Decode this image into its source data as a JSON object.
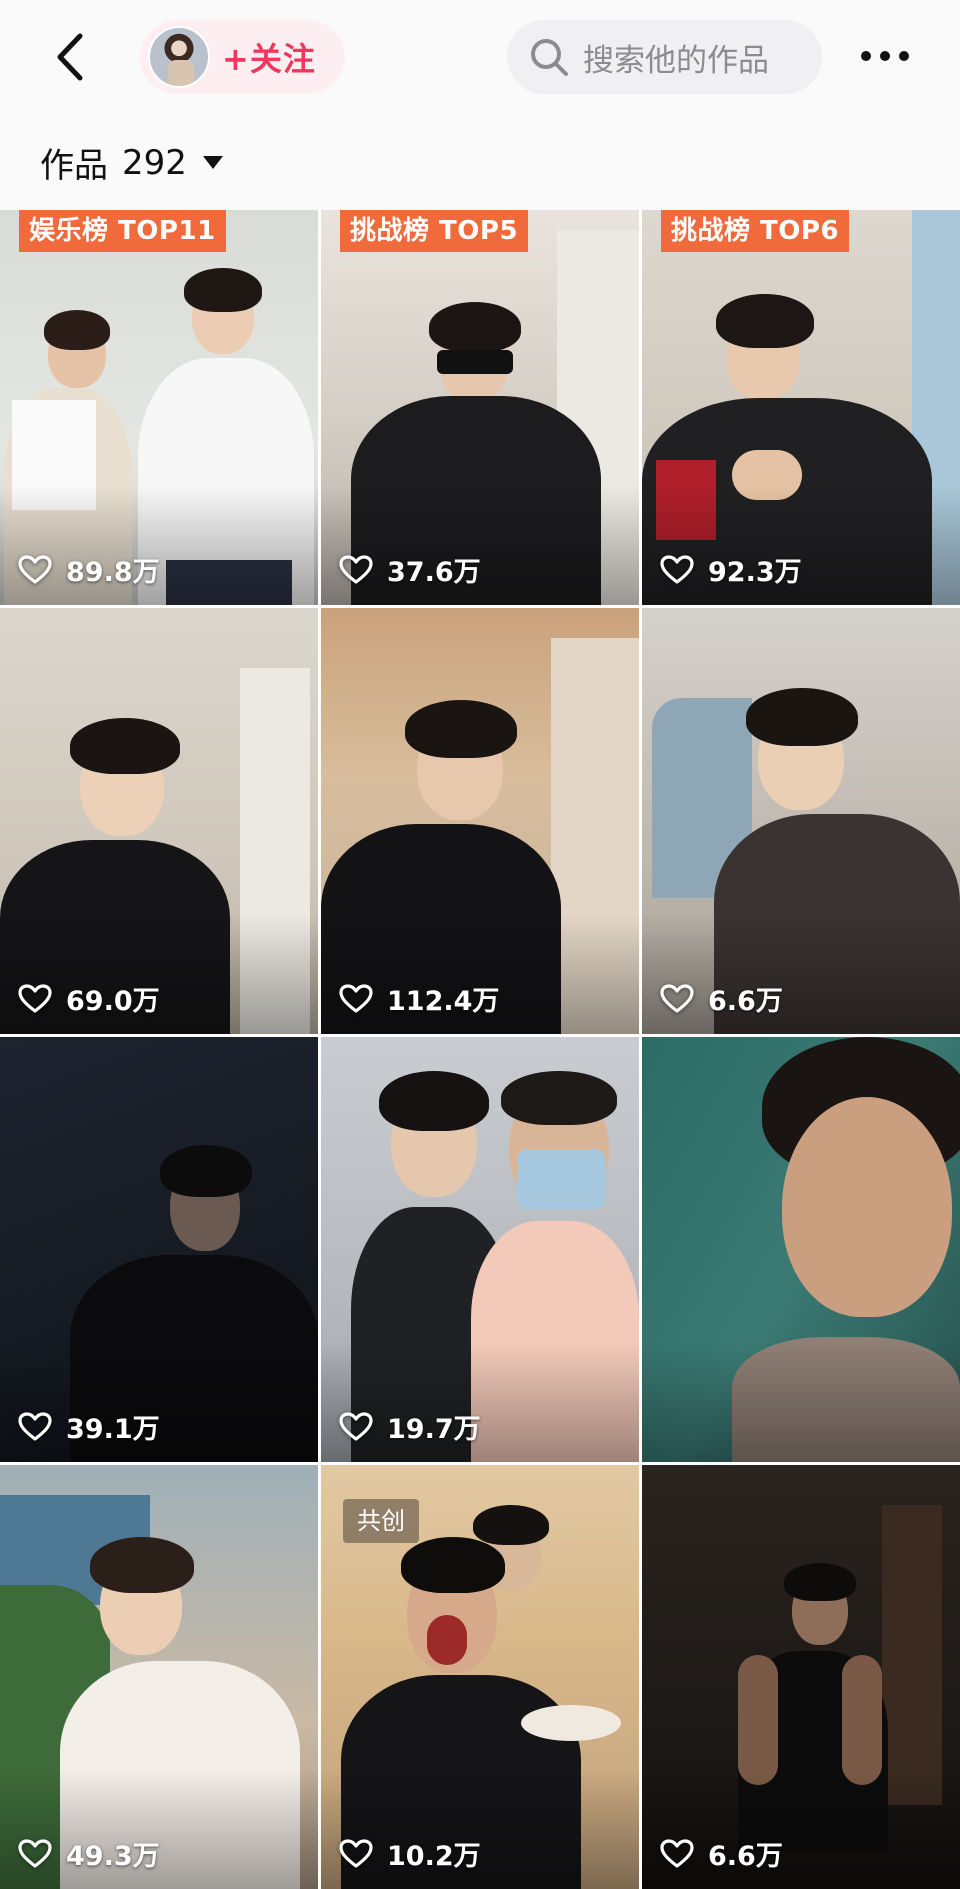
{
  "header": {
    "follow_label": "+关注",
    "search_placeholder": "搜索他的作品"
  },
  "works": {
    "label": "作品",
    "count": "292"
  },
  "colors": {
    "accent": "#f0385c",
    "badge": "#f06a3c"
  },
  "videos": [
    {
      "badge": "娱乐榜 TOP11",
      "likes": "89.8万"
    },
    {
      "badge": "挑战榜 TOP5",
      "likes": "37.6万"
    },
    {
      "badge": "挑战榜 TOP6",
      "likes": "92.3万"
    },
    {
      "badge": "",
      "likes": "69.0万"
    },
    {
      "badge": "",
      "likes": "112.4万"
    },
    {
      "badge": "",
      "likes": "6.6万"
    },
    {
      "badge": "",
      "likes": "39.1万"
    },
    {
      "badge": "",
      "likes": "19.7万"
    },
    {
      "badge": "",
      "likes": ""
    },
    {
      "badge": "",
      "likes": "49.3万"
    },
    {
      "badge": "",
      "likes": "10.2万",
      "tag": "共创"
    },
    {
      "badge": "",
      "likes": "6.6万"
    }
  ]
}
